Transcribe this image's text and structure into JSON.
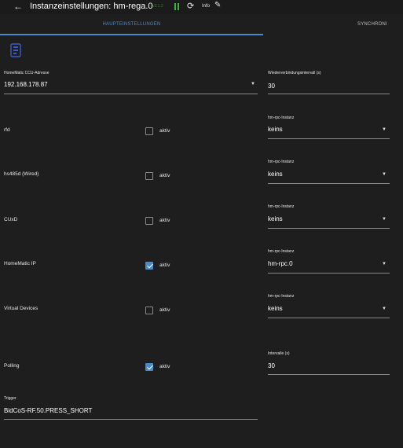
{
  "header": {
    "back_icon": "arrow-left-icon",
    "title": "Instanzeinstellungen: hm-rega.0",
    "version": "v3.1.2",
    "status_icon": "pause-icon",
    "reload_icon": "reload-icon",
    "info_label": "Info",
    "edit_icon": "pencil-icon",
    "colors": {
      "status": "#44b044",
      "accent": "#4a8ac9"
    }
  },
  "tabs": [
    {
      "label": "HAUPTEINSTELLUNGEN",
      "active": true
    },
    {
      "label": "SYNCHRONI",
      "active": false
    }
  ],
  "main": {
    "ccu": {
      "label": "HomeMatic CCU-Adresse",
      "value": "192.168.178.87"
    },
    "reconnect": {
      "label": "Wiederverbindungsintervall (s)",
      "value": "30"
    },
    "rows": [
      {
        "label": "rfd",
        "checkbox_label": "aktiv",
        "checked": false,
        "instance_label": "hm-rpc-Instanz",
        "instance_value": "keins"
      },
      {
        "label": "hs485d (Wired)",
        "checkbox_label": "aktiv",
        "checked": false,
        "instance_label": "hm-rpc-Instanz",
        "instance_value": "keins"
      },
      {
        "label": "CUxD",
        "checkbox_label": "aktiv",
        "checked": false,
        "instance_label": "hm-rpc-Instanz",
        "instance_value": "keins"
      },
      {
        "label": "HomeMatic IP",
        "checkbox_label": "aktiv",
        "checked": true,
        "instance_label": "hm-rpc-Instanz",
        "instance_value": "hm-rpc.0"
      },
      {
        "label": "Virtual Devices",
        "checkbox_label": "aktiv",
        "checked": false,
        "instance_label": "hm-rpc-Instanz",
        "instance_value": "keins"
      }
    ],
    "polling": {
      "label": "Polling",
      "checkbox_label": "aktiv",
      "checked": true,
      "interval_label": "Intervalle (s)",
      "interval_value": "30"
    },
    "trigger": {
      "label": "Trigger",
      "value": "BidCoS-RF.50.PRESS_SHORT"
    }
  }
}
